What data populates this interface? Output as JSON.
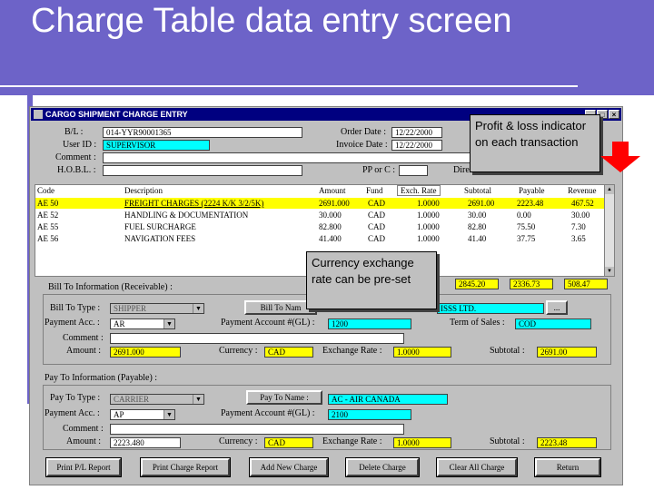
{
  "slide": {
    "title": "Charge Table data entry screen"
  },
  "window": {
    "title": "CARGO SHIPMENT CHARGE ENTRY",
    "btn_min": "_",
    "btn_max": "□",
    "btn_close": "×"
  },
  "header": {
    "bl_label": "B/L :",
    "bl_value": "014-YYR90001365",
    "order_date_label": "Order Date :",
    "order_date_value": "12/22/2000",
    "user_id_label": "User ID :",
    "user_id_value": "SUPERVISOR",
    "invoice_date_label": "Invoice Date :",
    "invoice_date_value": "12/22/2000",
    "comment_label": "Comment :",
    "comment_value": "",
    "hobl_label": "H.O.B.L. :",
    "hobl_value": "",
    "pp_or_c_label": "PP or C :",
    "pp_or_c_value": "",
    "direction_label": "Dire"
  },
  "grid": {
    "columns": [
      "Code",
      "Description",
      "Amount",
      "Fund",
      "Exch. Rate",
      "Subtotal",
      "Payable",
      "Revenue"
    ],
    "rows": [
      [
        "AE 50",
        "FREIGHT CHARGES (2224 K/K 3/2/5K)",
        "2691.000",
        "CAD",
        "1.0000",
        "2691.00",
        "2223.48",
        "467.52"
      ],
      [
        "AE 52",
        "HANDLING & DOCUMENTATION",
        "30.000",
        "CAD",
        "1.0000",
        "30.00",
        "0.00",
        "30.00"
      ],
      [
        "AE 55",
        "FUEL SURCHARGE",
        "82.800",
        "CAD",
        "1.0000",
        "82.80",
        "75.50",
        "7.30"
      ],
      [
        "AE 56",
        "NAVIGATION FEES",
        "41.400",
        "CAD",
        "1.0000",
        "41.40",
        "37.75",
        "3.65"
      ]
    ],
    "totals": {
      "subtotal": "2845.20",
      "payable": "2336.73",
      "revenue": "508.47"
    }
  },
  "bill_to": {
    "section_label": "Bill To Information (Receivable) :",
    "type_label": "Bill To Type :",
    "type_value": "SHIPPER",
    "name_button": "Bill To Nam",
    "name_value": "ISSS LTD.",
    "browse_button": "...",
    "payment_acc_label": "Payment Acc. :",
    "payment_acc_value": "AR",
    "payment_account_gl_label": "Payment Account #(GL) :",
    "payment_account_gl_value": "1200",
    "term_label": "Term of Sales :",
    "term_value": "COD",
    "comment_label": "Comment :",
    "comment_value": "",
    "amount_label": "Amount :",
    "amount_value": "2691.000",
    "currency_label": "Currency :",
    "currency_value": "CAD",
    "exchange_rate_label": "Exchange Rate :",
    "exchange_rate_value": "1.0000",
    "subtotal_label": "Subtotal :",
    "subtotal_value": "2691.00"
  },
  "pay_to": {
    "section_label": "Pay To Information (Payable) :",
    "type_label": "Pay To Type :",
    "type_value": "CARRIER",
    "name_button": "Pay To Name :",
    "name_value": "AC - AIR CANADA",
    "payment_acc_label": "Payment Acc. :",
    "payment_acc_value": "AP",
    "payment_account_gl_label": "Payment Account #(GL) :",
    "payment_account_gl_value": "2100",
    "comment_label": "Comment :",
    "comment_value": "",
    "amount_label": "Amount :",
    "amount_value": "2223.480",
    "currency_label": "Currency :",
    "currency_value": "CAD",
    "exchange_rate_label": "Exchange Rate :",
    "exchange_rate_value": "1.0000",
    "subtotal_label": "Subtotal :",
    "subtotal_value": "2223.48"
  },
  "buttons": {
    "print_pl": "Print P/L Report",
    "print_charge": "Print Charge Report",
    "add_new": "Add New Charge",
    "delete": "Delete Charge",
    "clear_all": "Clear All Charge",
    "return": "Return"
  },
  "callouts": {
    "profit": "Profit & loss indicator on each transaction",
    "currency": "Currency exchange rate can be pre-set"
  },
  "colors": {
    "header": "#6d63c8",
    "titlebar": "#000080",
    "highlight_yellow": "#ffff00",
    "highlight_cyan": "#00ffff",
    "arrow": "#ff0000"
  }
}
